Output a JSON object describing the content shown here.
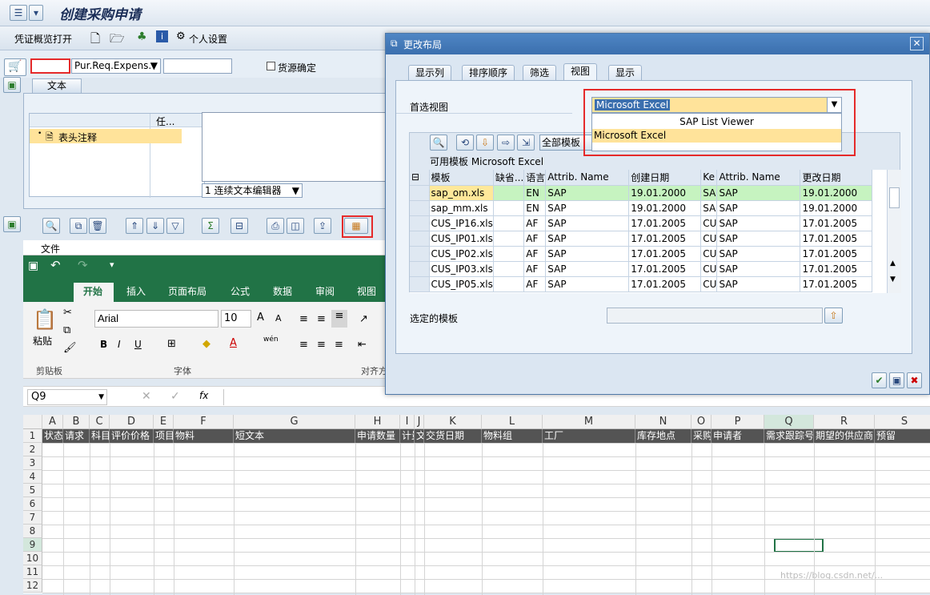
{
  "window": {
    "title": "创建采购申请"
  },
  "appbar": {
    "items": [
      "凭证概览打开",
      "个人设置"
    ]
  },
  "header": {
    "doc_type": "Pur.Req.Expens.",
    "source_check": "货源确定"
  },
  "text_panel": {
    "tab": "文本",
    "col_task": "任...",
    "item": "表头注释",
    "editor": "1 连续文本编辑器"
  },
  "file_label": "文件",
  "excel": {
    "tabs": [
      "开始",
      "插入",
      "页面布局",
      "公式",
      "数据",
      "审阅",
      "视图"
    ],
    "font_name": "Arial",
    "font_size": "10",
    "paste": "粘贴",
    "groups": {
      "clipboard": "剪贴板",
      "font": "字体",
      "align": "对齐方"
    },
    "name_box": "Q9",
    "wen": "wén",
    "columns": [
      "A",
      "B",
      "C",
      "D",
      "E",
      "F",
      "G",
      "H",
      "I",
      "J",
      "K",
      "L",
      "M",
      "N",
      "O",
      "P",
      "Q",
      "R",
      "S"
    ],
    "rows": [
      "1",
      "2",
      "3",
      "4",
      "5",
      "6",
      "7",
      "8",
      "9",
      "10",
      "11",
      "12"
    ],
    "header_row": [
      "状态",
      "请求",
      "科目",
      "评价价格",
      "项目",
      "物料",
      "短文本",
      "申请数量",
      "计量",
      "文",
      "交货日期",
      "物料组",
      "工厂",
      "库存地点",
      "采购",
      "申请者",
      "需求跟踪号",
      "期望的供应商",
      "预留"
    ],
    "watermark": "https://blog.csdn.net/..."
  },
  "dialog": {
    "title": "更改布局",
    "tabs": [
      "显示列",
      "排序顺序",
      "筛选",
      "视图",
      "显示"
    ],
    "preferred_view_label": "首选视图",
    "preferred_view_value": "Microsoft Excel",
    "dropdown_options": [
      "SAP List Viewer",
      "Microsoft Excel"
    ],
    "all_templates": "全部模板",
    "available_templates": "可用模板 Microsoft Excel",
    "table": {
      "headers": [
        "模板",
        "缺省...",
        "语言",
        "Attrib. Name",
        "创建日期",
        "Ke",
        "Attrib. Name",
        "更改日期"
      ],
      "rows": [
        [
          "sap_om.xls",
          "",
          "EN",
          "SAP",
          "19.01.2000",
          "SA",
          "SAP",
          "19.01.2000"
        ],
        [
          "sap_mm.xls",
          "",
          "EN",
          "SAP",
          "19.01.2000",
          "SA",
          "SAP",
          "19.01.2000"
        ],
        [
          "CUS_IP16.xls",
          "",
          "AF",
          "SAP",
          "17.01.2005",
          "CU",
          "SAP",
          "17.01.2005"
        ],
        [
          "CUS_IP01.xls",
          "",
          "AF",
          "SAP",
          "17.01.2005",
          "CU",
          "SAP",
          "17.01.2005"
        ],
        [
          "CUS_IP02.xls",
          "",
          "AF",
          "SAP",
          "17.01.2005",
          "CU",
          "SAP",
          "17.01.2005"
        ],
        [
          "CUS_IP03.xls",
          "",
          "AF",
          "SAP",
          "17.01.2005",
          "CU",
          "SAP",
          "17.01.2005"
        ],
        [
          "CUS_IP05.xls",
          "",
          "AF",
          "SAP",
          "17.01.2005",
          "CU",
          "SAP",
          "17.01.2005"
        ]
      ]
    },
    "selected_template_label": "选定的模板"
  }
}
